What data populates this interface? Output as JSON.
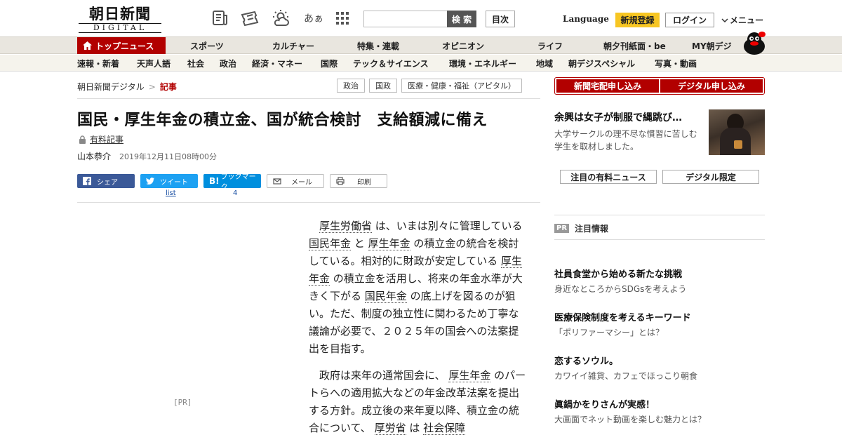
{
  "header": {
    "logo_main": "朝日新聞",
    "logo_sub": "DIGITAL",
    "search_placeholder": "",
    "search_button": "検 索",
    "toc_button": "目次",
    "language": "Language",
    "register": "新規登録",
    "login": "ログイン",
    "menu": "メニュー",
    "icon_font_glyph": "あぁ"
  },
  "main_nav": [
    "トップニュース",
    "スポーツ",
    "カルチャー",
    "特集・連載",
    "オピニオン",
    "ライフ",
    "朝夕刊紙面・be",
    "MY朝デジ"
  ],
  "sub_nav": [
    "速報・新着",
    "天声人語",
    "社会",
    "政治",
    "経済・マネー",
    "国際",
    "テック＆サイエンス",
    "環境・エネルギー",
    "地域",
    "朝デジスペシャル",
    "写真・動画"
  ],
  "breadcrumb": {
    "home": "朝日新聞デジタル",
    "sep": ">",
    "current": "記事"
  },
  "tags": [
    "政治",
    "国政",
    "医療・健康・福祉（アピタル）"
  ],
  "article": {
    "headline": "国民・厚生年金の積立金、国が統合検討　支給額減に備え",
    "paid_label": "有料記事",
    "author": "山本恭介",
    "date": "2019年12月11日08時00分",
    "share": {
      "facebook": "シェア",
      "twitter": "ツイート",
      "twitter_count": "list",
      "hatena": "ブックマーク",
      "hatena_count": "4",
      "mail": "メール",
      "print": "印刷"
    },
    "pr_ad": "[PR]",
    "p1": [
      {
        "t": "厚生労働省",
        "kw": true
      },
      {
        "t": " は、いまは別々に管理している ",
        "kw": false
      },
      {
        "t": "国民年金",
        "kw": true
      },
      {
        "t": " と ",
        "kw": false
      },
      {
        "t": "厚生年金",
        "kw": true
      },
      {
        "t": " の積立金の統合を検討している。相対的に財政が安定している ",
        "kw": false
      },
      {
        "t": "厚生年金",
        "kw": true
      },
      {
        "t": " の積立金を活用し、将来の年金水準が大きく下がる ",
        "kw": false
      },
      {
        "t": "国民年金",
        "kw": true
      },
      {
        "t": " の底上げを図るのが狙い。ただ、制度の独立性に関わるため丁寧な議論が必要で、２０２５年の国会への法案提出を目指す。",
        "kw": false
      }
    ],
    "p2": [
      {
        "t": "政府は来年の通常国会に、 ",
        "kw": false
      },
      {
        "t": "厚生年金",
        "kw": true
      },
      {
        "t": " のパートらへの適用拡大などの年金改革法案を提出する方針。成立後の来年夏以降、積立金の統合について、 ",
        "kw": false
      },
      {
        "t": "厚労省",
        "kw": true
      },
      {
        "t": " は ",
        "kw": false
      },
      {
        "t": "社会保障",
        "kw": true
      }
    ]
  },
  "right": {
    "buttons": [
      "新聞宅配申し込み",
      "デジタル申し込み"
    ],
    "feature_title": "余興は女子が制服で縄跳び…",
    "feature_desc": "大学サークルの理不尽な慣習に苦しむ学生を取材しました。",
    "tabs": [
      "注目の有料ニュース",
      "デジタル限定"
    ],
    "pr_badge": "PR",
    "pr_heading": "注目情報",
    "pr_items": [
      {
        "title": "社員食堂から始める新たな挑戦",
        "desc": "身近なところからSDGsを考えよう"
      },
      {
        "title": "医療保険制度を考えるキーワード",
        "desc": "「ポリファーマシー」とは？"
      },
      {
        "title": "恋するソウル。",
        "desc": "カワイイ雑貨、カフェでほっこり朝食"
      },
      {
        "title": "眞鍋かをりさんが実感！",
        "desc": "大画面でネット動画を楽しむ魅力とは？"
      }
    ]
  }
}
